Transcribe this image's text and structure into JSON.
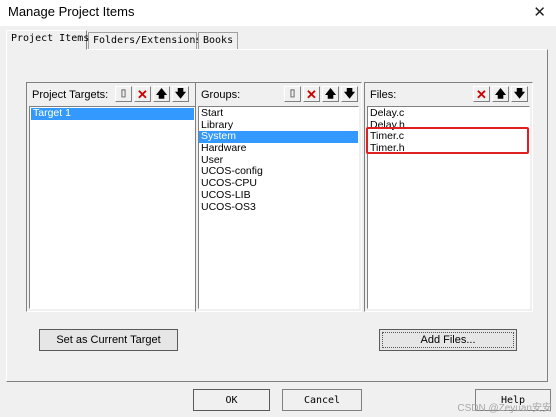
{
  "window": {
    "title": "Manage Project Items",
    "close_glyph": "✕"
  },
  "tabs": [
    {
      "label": "Project Items"
    },
    {
      "label": "Folders/Extensions"
    },
    {
      "label": "Books"
    }
  ],
  "targets": {
    "label": "Project Targets:",
    "items": [
      "Target 1"
    ],
    "selected_index": 0
  },
  "groups": {
    "label": "Groups:",
    "items": [
      "Start",
      "Library",
      "System",
      "Hardware",
      "User",
      "UCOS-config",
      "UCOS-CPU",
      "UCOS-LIB",
      "UCOS-OS3"
    ],
    "selected_index": 2
  },
  "files": {
    "label": "Files:",
    "items": [
      "Delay.c",
      "Delay.h",
      "Timer.c",
      "Timer.h"
    ]
  },
  "toolbar_icons": {
    "new": "▯",
    "delete": "✕",
    "up": "🡅",
    "down": "🡇"
  },
  "buttons": {
    "set_current": "Set as Current Target",
    "add_files": "Add Files...",
    "ok": "OK",
    "cancel": "Cancel",
    "help": "Help"
  },
  "watermark": "CSDN @Zeyuan安安",
  "colors": {
    "selection": "#3399ff",
    "highlight_box": "#e02020"
  }
}
